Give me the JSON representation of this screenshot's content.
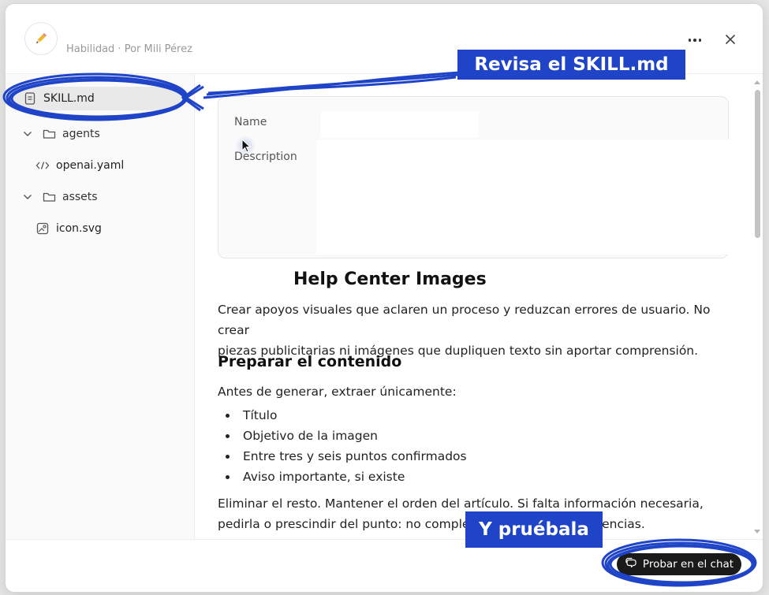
{
  "header": {
    "subtitle": "Habilidad · Por Mili Pérez",
    "icon": "pencil-icon",
    "more_icon": "more-horizontal-icon",
    "close_icon": "close-icon"
  },
  "sidebar": {
    "items": [
      {
        "label": "SKILL.md",
        "icon": "file-text-icon",
        "selected": true
      },
      {
        "label": "agents",
        "icon": "folder-icon",
        "expanded": true
      },
      {
        "label": "openai.yaml",
        "icon": "code-icon"
      },
      {
        "label": "assets",
        "icon": "folder-icon",
        "expanded": true
      },
      {
        "label": "icon.svg",
        "icon": "image-icon"
      }
    ]
  },
  "meta": {
    "name_label": "Name",
    "description_label": "Description"
  },
  "document": {
    "title": "Help Center Images",
    "intro_line1": "Crear apoyos visuales que aclaren un proceso y reduzcan errores de usuario. No crear",
    "intro_line2": "piezas publicitarias ni imágenes que dupliquen texto sin aportar comprensión.",
    "section_heading": "Preparar el contenido",
    "before_list": "Antes de generar, extraer únicamente:",
    "list": [
      "Título",
      "Objetivo de la imagen",
      "Entre tres y seis puntos confirmados",
      "Aviso importante, si existe"
    ],
    "after_line1": "Eliminar el resto. Mantener el orden del artículo. Si falta información necesaria,",
    "after_line2_start": "pedirla o prescindir del punto: no complet",
    "after_line2_end": "erencias."
  },
  "footer": {
    "try_button": "Probar en el chat",
    "try_icon": "chat-icon"
  },
  "annotations": {
    "callout_top": "Revisa el SKILL.md",
    "callout_bottom": "Y pruébala",
    "color": "#1f44c8"
  }
}
